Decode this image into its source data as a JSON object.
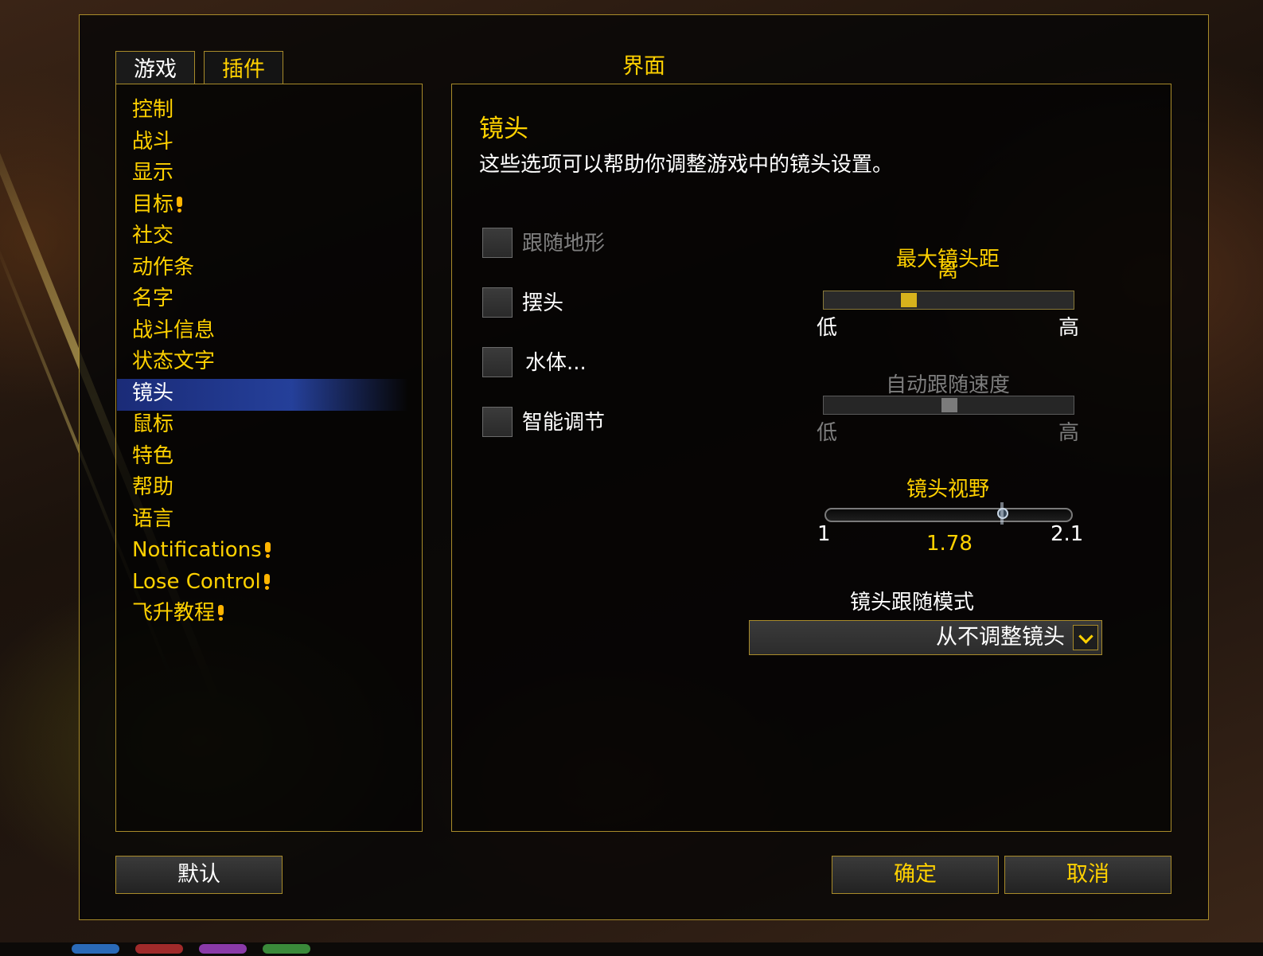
{
  "window": {
    "title": "界面"
  },
  "tabs": [
    {
      "label": "游戏",
      "active": true
    },
    {
      "label": "插件",
      "active": false
    }
  ],
  "categories": [
    {
      "label": "控制",
      "alert": false
    },
    {
      "label": "战斗",
      "alert": false
    },
    {
      "label": "显示",
      "alert": false
    },
    {
      "label": "目标",
      "alert": true
    },
    {
      "label": "社交",
      "alert": false
    },
    {
      "label": "动作条",
      "alert": false
    },
    {
      "label": "名字",
      "alert": false
    },
    {
      "label": "战斗信息",
      "alert": false
    },
    {
      "label": "状态文字",
      "alert": false
    },
    {
      "label": "镜头",
      "alert": false,
      "selected": true
    },
    {
      "label": "鼠标",
      "alert": false
    },
    {
      "label": "特色",
      "alert": false
    },
    {
      "label": "帮助",
      "alert": false
    },
    {
      "label": "语言",
      "alert": false
    },
    {
      "label": "Notifications",
      "alert": true
    },
    {
      "label": "Lose Control",
      "alert": true
    },
    {
      "label": "飞升教程",
      "alert": true
    }
  ],
  "section": {
    "title": "镜头",
    "description": "这些选项可以帮助你调整游戏中的镜头设置。"
  },
  "checkboxes": [
    {
      "label": "跟随地形",
      "checked": false,
      "disabled": true
    },
    {
      "label": "摆头",
      "checked": false,
      "disabled": false
    },
    {
      "label": "水体...",
      "checked": false,
      "disabled": false
    },
    {
      "label": "智能调节",
      "checked": false,
      "disabled": false
    }
  ],
  "sliders": {
    "max_distance": {
      "title": "最大镜头距离",
      "title_line1": "最大镜头距",
      "title_line2": "离",
      "low": "低",
      "high": "高",
      "value_fraction": 0.34,
      "disabled": false
    },
    "follow_speed": {
      "title": "自动跟随速度",
      "low": "低",
      "high": "高",
      "value_fraction": 0.5,
      "disabled": true
    },
    "fov": {
      "title": "镜头视野",
      "min": "1",
      "max": "2.1",
      "value": "1.78",
      "min_value": 1,
      "max_value": 2.1,
      "current": 1.78
    }
  },
  "follow_mode": {
    "label": "镜头跟随模式",
    "selected": "从不调整镜头"
  },
  "buttons": {
    "defaults": "默认",
    "ok": "确定",
    "cancel": "取消"
  },
  "colors": {
    "gold": "#ffd100",
    "border": "#a88b2a",
    "selection": "#2a46a8",
    "alert": "#ffb400"
  }
}
